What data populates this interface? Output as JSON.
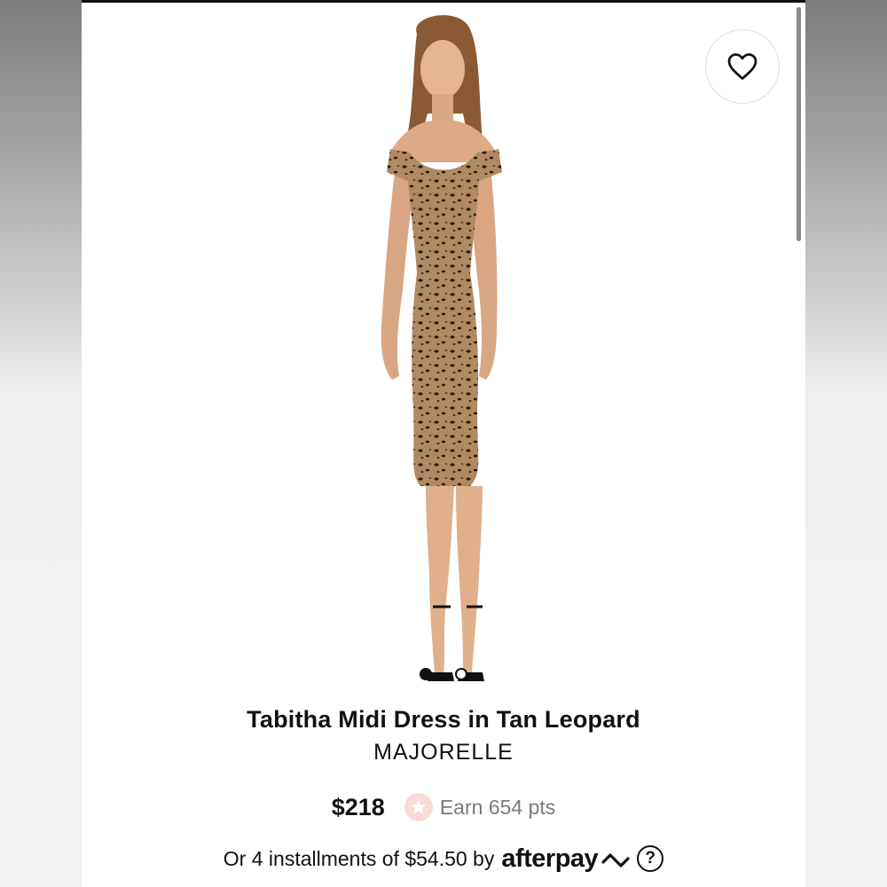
{
  "product": {
    "title": "Tabitha Midi Dress in Tan Leopard",
    "brand": "MAJORELLE",
    "price": "$218",
    "points": "Earn 654 pts"
  },
  "gallery": {
    "slide_count": 2,
    "active_index": 1,
    "icons": {
      "favorite": "heart-outline-icon",
      "points": "star-icon"
    }
  },
  "payment": {
    "installments_text": "Or 4 installments of $54.50 by",
    "provider": "afterpay",
    "help_label": "?"
  },
  "colors": {
    "accent_pink": "#f6dcd7",
    "text": "#111111",
    "muted": "#7a7a7a",
    "dress_tan": "#b08a62"
  }
}
